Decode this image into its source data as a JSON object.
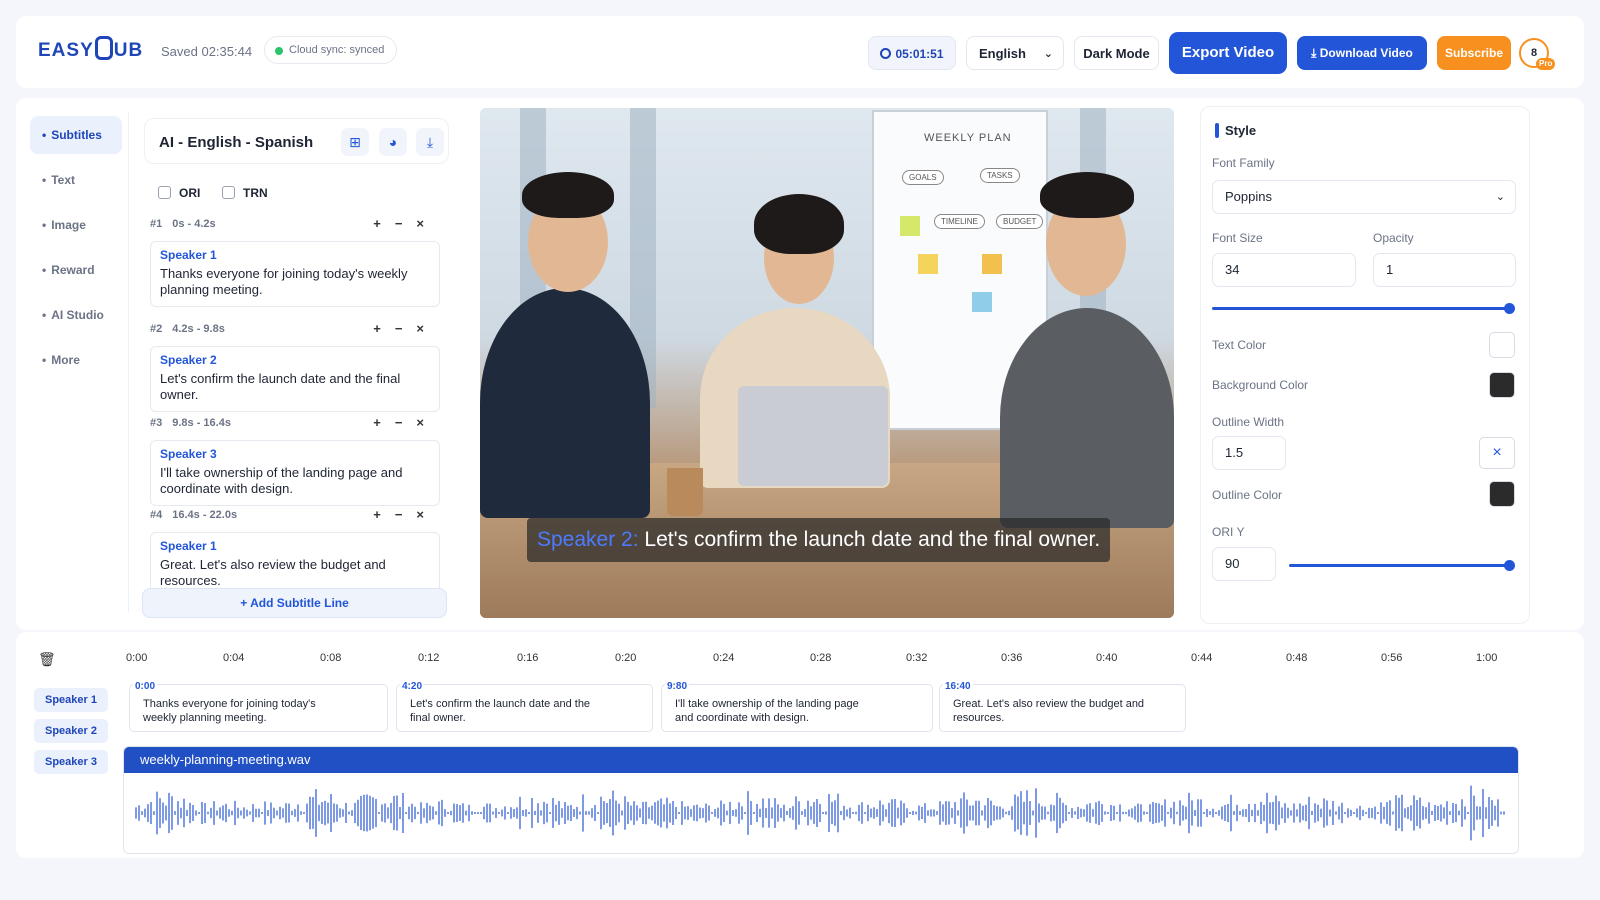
{
  "header": {
    "logo": "EASYSUB",
    "logo_left": "EASY",
    "logo_right": "UB",
    "saved": "Saved 02:35:44",
    "sync": "Cloud sync: synced",
    "timer": "05:01:51",
    "language": "English",
    "dark_mode": "Dark Mode",
    "export": "Export Video",
    "download": "Download Video",
    "subscribe": "Subscribe",
    "avatar_count": "8",
    "pro": "Pro"
  },
  "nav": {
    "items": [
      "Subtitles",
      "Text",
      "Image",
      "Reward",
      "AI Studio",
      "More"
    ],
    "active": "Subtitles"
  },
  "subtitles": {
    "title": "AI - English - Spanish",
    "checkbox_ori": "ORI",
    "checkbox_trn": "TRN",
    "add_line": "+ Add Subtitle Line",
    "items": [
      {
        "num": "#1",
        "time": "0s - 4.2s",
        "speaker": "Speaker 1",
        "text": "Thanks everyone for joining today's weekly planning meeting."
      },
      {
        "num": "#2",
        "time": "4.2s - 9.8s",
        "speaker": "Speaker 2",
        "text": "Let's confirm the launch date and the final owner."
      },
      {
        "num": "#3",
        "time": "9.8s - 16.4s",
        "speaker": "Speaker 3",
        "text": "I'll take ownership of the landing page and coordinate with design."
      },
      {
        "num": "#4",
        "time": "16.4s - 22.0s",
        "speaker": "Speaker 1",
        "text": "Great. Let's also review the budget and resources."
      }
    ]
  },
  "video": {
    "caption_speaker": "Speaker 2:",
    "caption_text": "Let's confirm the launch date and the final owner.",
    "board_title": "WEEKLY PLAN",
    "board_nodes": [
      "GOALS",
      "TASKS",
      "TIMELINE",
      "BUDGET"
    ]
  },
  "style": {
    "title": "Style",
    "font_family_label": "Font Family",
    "font_family": "Poppins",
    "font_size_label": "Font Size",
    "font_size": "34",
    "opacity_label": "Opacity",
    "opacity": "1",
    "opacity_slider_fraction": 1.0,
    "text_color_label": "Text Color",
    "text_color": "#ffffff",
    "bg_color_label": "Background Color",
    "bg_color": "#2b2b2b",
    "outline_width_label": "Outline Width",
    "outline_width": "1.5",
    "outline_color_label": "Outline Color",
    "outline_color": "#2b2b2b",
    "ori_y_label": "ORI Y",
    "ori_y": "90",
    "ori_y_slider_fraction": 1.0
  },
  "timeline": {
    "ticks": [
      "0:00",
      "0:04",
      "0:08",
      "0:12",
      "0:16",
      "0:20",
      "0:24",
      "0:28",
      "0:32",
      "0:36",
      "0:40",
      "0:44",
      "0:48",
      "0:56",
      "1:00"
    ],
    "speakers": [
      "Speaker 1",
      "Speaker 2",
      "Speaker 3"
    ],
    "clips": [
      {
        "time": "0:00",
        "text": "Thanks everyone for joining today's weekly planning meeting."
      },
      {
        "time": "4:20",
        "text": "Let's confirm the launch date and the final owner."
      },
      {
        "time": "9:80",
        "text": "I'll take ownership of the landing page and coordinate with design."
      },
      {
        "time": "16:40",
        "text": "Great. Let's also review the budget and resources."
      }
    ],
    "audio_file": "weekly-planning-meeting.wav"
  },
  "colors": {
    "accent": "#2255d8",
    "subscribe": "#f7901e",
    "sync_dot": "#2cc46a"
  },
  "icons": [
    "clock-icon",
    "chevron-down-icon",
    "download-icon",
    "layout-icon",
    "palette-icon",
    "trash-icon",
    "plus-icon",
    "minus-icon",
    "close-icon"
  ]
}
